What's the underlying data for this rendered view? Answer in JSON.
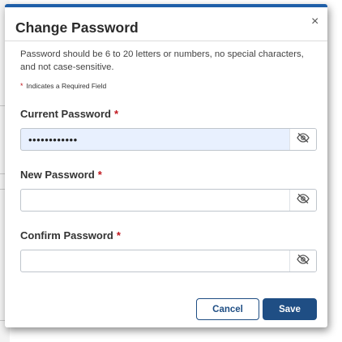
{
  "dialog": {
    "title": "Change Password",
    "close_glyph": "×",
    "description": "Password should be 6 to 20 letters or numbers, no special characters, and not case-sensitive.",
    "required_note": {
      "marker": "*",
      "text": "Indicates a Required Field"
    },
    "fields": [
      {
        "label": "Current Password",
        "required_marker": "*",
        "value": "••••••••••••",
        "placeholder": "",
        "toggle_icon": "eye-slash-icon"
      },
      {
        "label": "New Password",
        "required_marker": "*",
        "value": "",
        "placeholder": "",
        "toggle_icon": "eye-slash-icon"
      },
      {
        "label": "Confirm Password",
        "required_marker": "*",
        "value": "",
        "placeholder": "",
        "toggle_icon": "eye-slash-icon"
      }
    ],
    "buttons": {
      "cancel_label": "Cancel",
      "save_label": "Save"
    }
  },
  "colors": {
    "accent": "#1f5fa8",
    "primary_button": "#1f4e84",
    "required": "#c0161d",
    "filled_field": "#e8f0fe"
  }
}
